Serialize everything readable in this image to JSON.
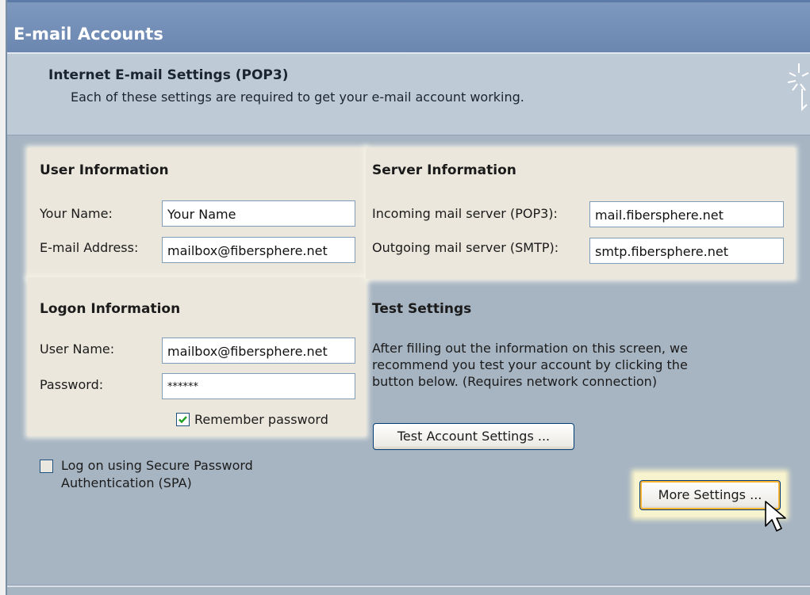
{
  "window": {
    "title": "E-mail Accounts"
  },
  "header": {
    "title": "Internet E-mail Settings (POP3)",
    "subtitle": "Each of these settings are required to get your e-mail account working."
  },
  "user_information": {
    "title": "User Information",
    "name_label": "Your Name:",
    "name_value": "Your Name",
    "email_label": "E-mail Address:",
    "email_value": "mailbox@fibersphere.net"
  },
  "server_information": {
    "title": "Server Information",
    "incoming_label": "Incoming mail server (POP3):",
    "incoming_value": "mail.fibersphere.net",
    "outgoing_label": "Outgoing mail server (SMTP):",
    "outgoing_value": "smtp.fibersphere.net"
  },
  "logon_information": {
    "title": "Logon Information",
    "username_label": "User Name:",
    "username_value": "mailbox@fibersphere.net",
    "password_label": "Password:",
    "password_value": "******",
    "remember_label": "Remember password",
    "remember_checked": true,
    "spa_label_line1": "Log on using Secure Password",
    "spa_label_line2": "Authentication (SPA)",
    "spa_checked": false
  },
  "test_settings": {
    "title": "Test Settings",
    "line1": "After filling out the information on this screen, we",
    "line2": "recommend you test your account by clicking the",
    "line3": "button below. (Requires network connection)",
    "test_button": "Test Account Settings ...",
    "more_button": "More Settings ..."
  },
  "colors": {
    "window_bg": "#a7b5c3",
    "panel_bg": "#ebe7dc",
    "titlebar": "#6a86b0",
    "button_highlight": "#f8b332",
    "checkbox_check": "#21a121"
  },
  "icons": [
    "wizard-sparkle-icon",
    "checkmark-icon",
    "mouse-pointer-icon"
  ]
}
